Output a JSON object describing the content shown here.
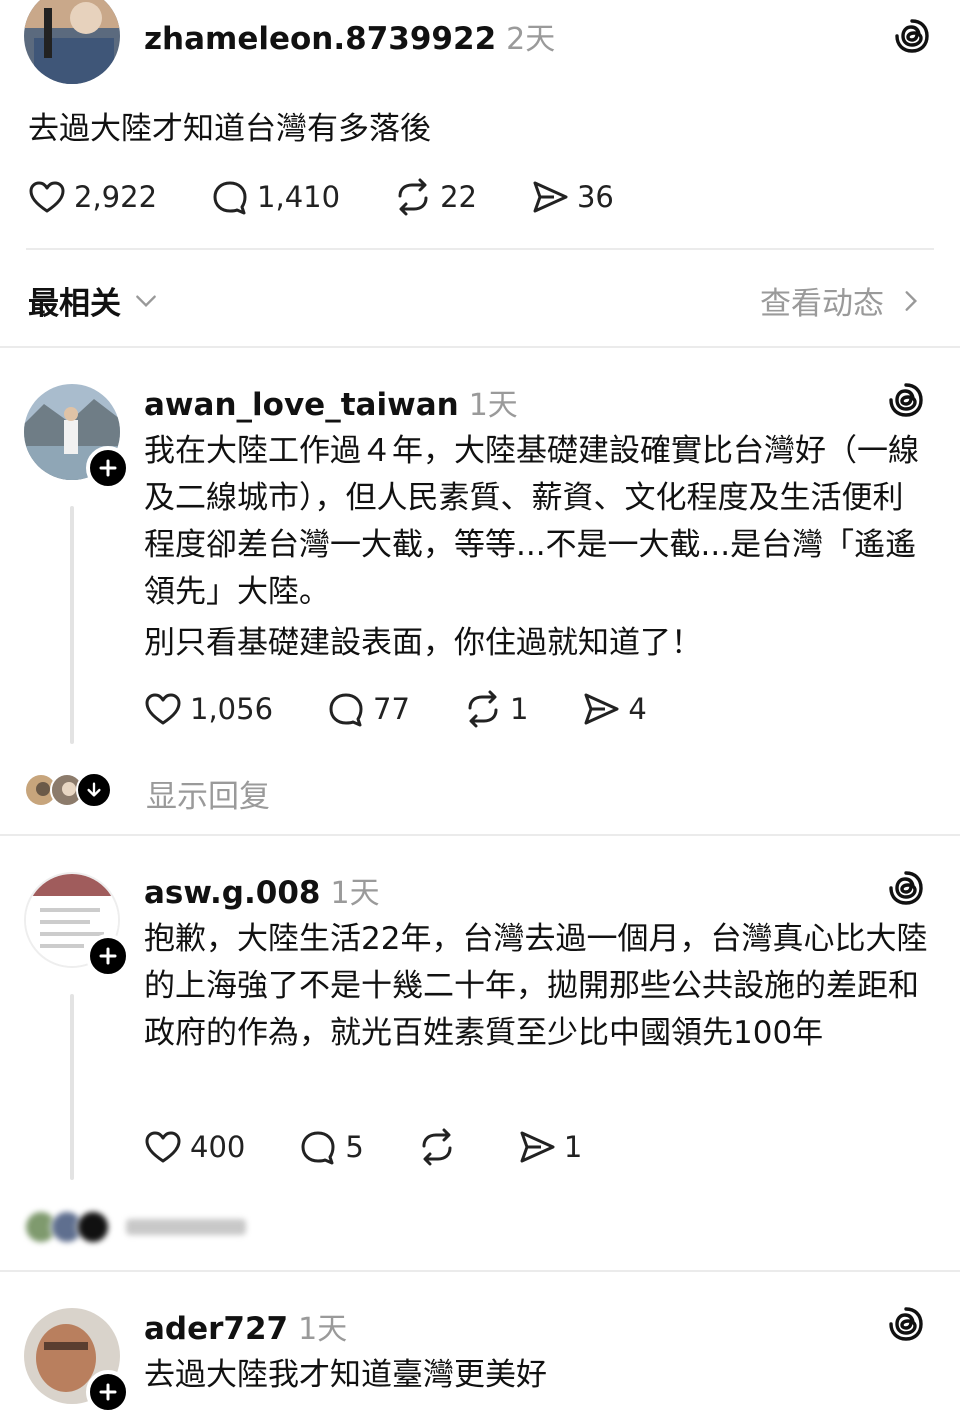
{
  "op": {
    "username": "zhameleon.8739922",
    "time": "2天",
    "text": "去過大陸才知道台灣有多落後",
    "likes": "2,922",
    "replies": "1,410",
    "reposts": "22",
    "shares": "36"
  },
  "sort": {
    "label": "最相关",
    "activity_label": "查看动态"
  },
  "comments": [
    {
      "username": "awan_love_taiwan",
      "time": "1天",
      "paragraphs": [
        "我在大陸工作過４年，大陸基礎建設確實比台灣好（一線及二線城市），但人民素質、薪資、文化程度及生活便利程度卻差台灣一大截，等等...不是一大截...是台灣「遙遙領先」大陸。",
        "別只看基礎建設表面，你住過就知道了！"
      ],
      "likes": "1,056",
      "replies": "77",
      "reposts": "1",
      "shares": "4",
      "show_replies": "显示回复"
    },
    {
      "username": "asw.g.008",
      "time": "1天",
      "paragraphs": [
        "抱歉，大陸生活22年，台灣去過一個月，台灣真心比大陸的上海強了不是十幾二十年，拋開那些公共設施的差距和政府的作為，就光百姓素質至少比中國領先100年"
      ],
      "likes": "400",
      "replies": "5",
      "reposts": "",
      "shares": "1"
    },
    {
      "username": "ader727",
      "time": "1天",
      "paragraphs": [
        "去過大陸我才知道臺灣更美好"
      ]
    }
  ],
  "colors": {
    "text": "#111111",
    "muted": "#9a9a9a",
    "divider": "#ebebeb"
  }
}
